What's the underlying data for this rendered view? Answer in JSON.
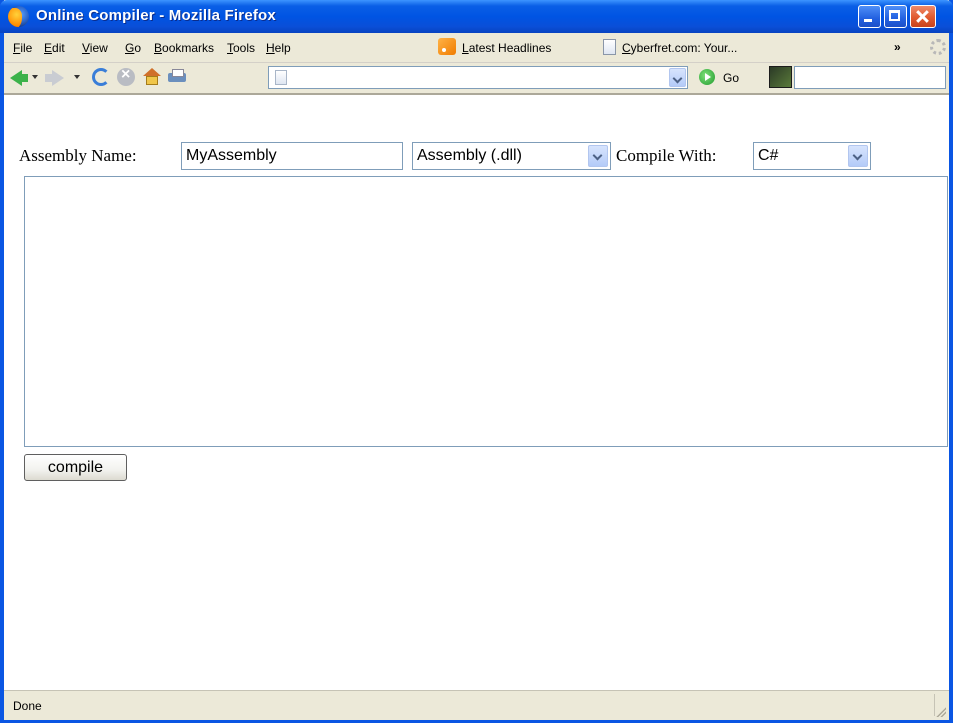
{
  "window": {
    "title": "Online Compiler - Mozilla Firefox"
  },
  "menubar": {
    "items": [
      "File",
      "Edit",
      "View",
      "Go",
      "Bookmarks",
      "Tools",
      "Help"
    ],
    "bookmarks": [
      {
        "label": "Latest Headlines",
        "icon": "rss-icon"
      },
      {
        "label": "Cyberfret.com: Your...",
        "icon": "page-icon"
      }
    ],
    "overflow_label": "»"
  },
  "navbar": {
    "url_value": "",
    "go_label": "Go",
    "search_value": ""
  },
  "form": {
    "assembly_name_label": "Assembly Name:",
    "assembly_name_value": "MyAssembly",
    "output_type_selected": "Assembly (.dll)",
    "compile_with_label": "Compile With:",
    "language_selected": "C#",
    "source_code": "",
    "compile_button_label": "compile"
  },
  "statusbar": {
    "text": "Done"
  },
  "colors": {
    "titlebar": "#0054e3",
    "chrome": "#ece9d8",
    "input_border": "#7f9db9"
  }
}
